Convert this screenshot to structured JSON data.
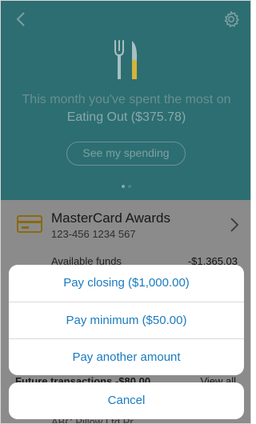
{
  "insight": {
    "headline_prefix": "This month you've spent the most on ",
    "category": "Eating Out",
    "amount": "($375.78)",
    "button_label": "See my spending",
    "pager": {
      "count": 2,
      "active_index": 0
    }
  },
  "card": {
    "name": "MasterCard Awards",
    "number": "123-456  1234 567",
    "available_label": "Available funds",
    "available_value": "-$1,365.03"
  },
  "transactions": {
    "future_label": "Future transactions -$80.00",
    "view_all_label": "View all",
    "row_partial": "ABC Pillow Ltd Pr"
  },
  "action_sheet": {
    "options": [
      {
        "label": "Pay closing ($1,000.00)"
      },
      {
        "label": "Pay minimum ($50.00)"
      },
      {
        "label": "Pay another amount"
      }
    ],
    "cancel_label": "Cancel"
  },
  "colors": {
    "hero_background": "#2c6e72",
    "card_accent": "#c9a227",
    "action_text": "#1a7bbf",
    "knife_handle": "#d6b43a"
  },
  "icons": {
    "back": "chevron-left-icon",
    "settings": "gear-icon",
    "cutlery": "fork-knife-icon",
    "card": "credit-card-icon",
    "card_link": "chevron-right-icon"
  }
}
